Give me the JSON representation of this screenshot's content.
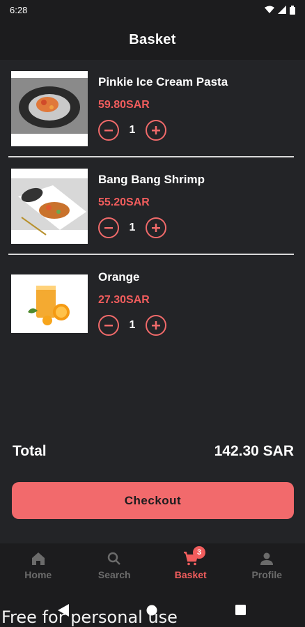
{
  "status_bar": {
    "time": "6:28"
  },
  "app_bar": {
    "title": "Basket"
  },
  "items": [
    {
      "name": "Pinkie Ice Cream Pasta",
      "price": "59.80SAR",
      "quantity": "1"
    },
    {
      "name": "Bang Bang Shrimp",
      "price": "55.20SAR",
      "quantity": "1"
    },
    {
      "name": "Orange",
      "price": "27.30SAR",
      "quantity": "1"
    }
  ],
  "total": {
    "label": "Total",
    "value": "142.30 SAR"
  },
  "checkout": {
    "label": "Checkout"
  },
  "bottom_nav": {
    "items": [
      {
        "label": "Home",
        "icon": "home-icon"
      },
      {
        "label": "Search",
        "icon": "search-icon"
      },
      {
        "label": "Basket",
        "icon": "cart-icon",
        "badge": "3",
        "active": true
      },
      {
        "label": "Profile",
        "icon": "person-icon"
      }
    ]
  },
  "watermark": "Free for personal use",
  "colors": {
    "accent": "#f15d5d",
    "button": "#f26a6c",
    "background": "#232427"
  }
}
